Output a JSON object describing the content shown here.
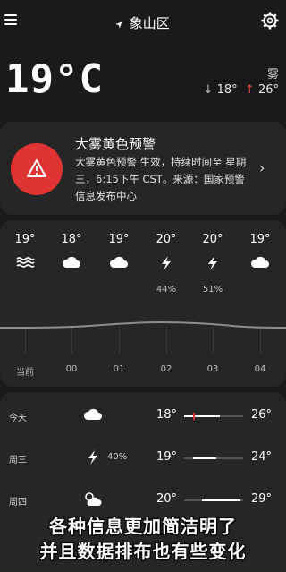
{
  "header": {
    "location": "象山区"
  },
  "current": {
    "temp": "19°C",
    "condition": "雾",
    "low": "18°",
    "high": "26°"
  },
  "alert": {
    "title": "大雾黄色预警",
    "body": "大雾黄色预警 生效，持续时间至 星期三，6:15下午 CST。来源：国家预警信息发布中心"
  },
  "hourly": [
    {
      "temp": "19°",
      "icon": "fog-icon",
      "pop": "",
      "time": "当前"
    },
    {
      "temp": "18°",
      "icon": "cloud-icon",
      "pop": "",
      "time": "00"
    },
    {
      "temp": "19°",
      "icon": "cloud-icon",
      "pop": "",
      "time": "01"
    },
    {
      "temp": "20°",
      "icon": "thunder-icon",
      "pop": "44%",
      "time": "02"
    },
    {
      "temp": "20°",
      "icon": "thunder-icon",
      "pop": "51%",
      "time": "03"
    },
    {
      "temp": "19°",
      "icon": "cloud-icon",
      "pop": "",
      "time": "04"
    }
  ],
  "daily": [
    {
      "day": "今天",
      "icon": "cloud-icon",
      "pop": "",
      "low": "18°",
      "high": "26°",
      "range": [
        0.0,
        0.6
      ],
      "current_marker": 0.15
    },
    {
      "day": "周三",
      "icon": "thunder-icon",
      "pop": "40%",
      "low": "19°",
      "high": "24°",
      "range": [
        0.15,
        0.55
      ]
    },
    {
      "day": "周四",
      "icon": "partly-cloudy-icon",
      "pop": "",
      "low": "20°",
      "high": "29°",
      "range": [
        0.3,
        0.95
      ]
    }
  ],
  "caption": {
    "line1": "各种信息更加简洁明了",
    "line2": "并且数据排布也有些变化"
  },
  "colors": {
    "accent_red": "#e03434",
    "card": "#262626",
    "background": "#1a1a1a"
  }
}
